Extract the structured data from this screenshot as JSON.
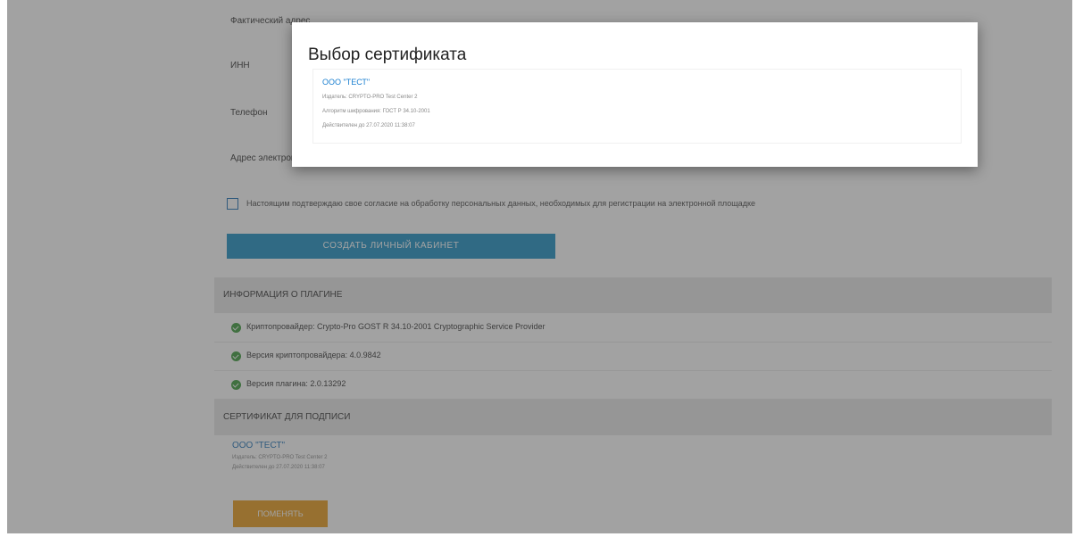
{
  "form": {
    "labels": [
      "Фактический адрес",
      "ИНН",
      "Телефон",
      "Адрес электронной почты"
    ],
    "consent_text": "Настоящим подтверждаю свое согласие на обработку персональных данных, необходимых для регистрации на электронной площадке",
    "create_button": "СОЗДАТЬ ЛИЧНЫЙ КАБИНЕТ"
  },
  "plugin_info": {
    "header": "ИНФОРМАЦИЯ О ПЛАГИНЕ",
    "rows": [
      "Криптопровайдер: Crypto-Pro GOST R 34.10-2001 Cryptographic Service Provider",
      "Версия криптопровайдера: 4.0.9842",
      "Версия плагина: 2.0.13292"
    ]
  },
  "signing_cert": {
    "header": "СЕРТИФИКАТ ДЛЯ ПОДПИСИ",
    "name": "ООО \"ТЕСТ\"",
    "issuer": "Издатель: CRYPTO-PRO Test Center 2",
    "valid_to": "Действителен до 27.07.2020 11:38:07",
    "change_button": "ПОМЕНЯТЬ"
  },
  "modal": {
    "title": "Выбор сертификата",
    "cert": {
      "name": "ООО \"ТЕСТ\"",
      "issuer": "Издатель: CRYPTO-PRO Test Center 2",
      "algorithm": "Алгоритм шифрования: ГОСТ Р 34.10-2001",
      "valid_to": "Действителен до 27.07.2020 11:38:07"
    }
  },
  "colors": {
    "link": "#1a7fd0",
    "primary_button": "#1a8fc3",
    "secondary_button": "#e89a1a",
    "success": "#3a9a3a"
  }
}
